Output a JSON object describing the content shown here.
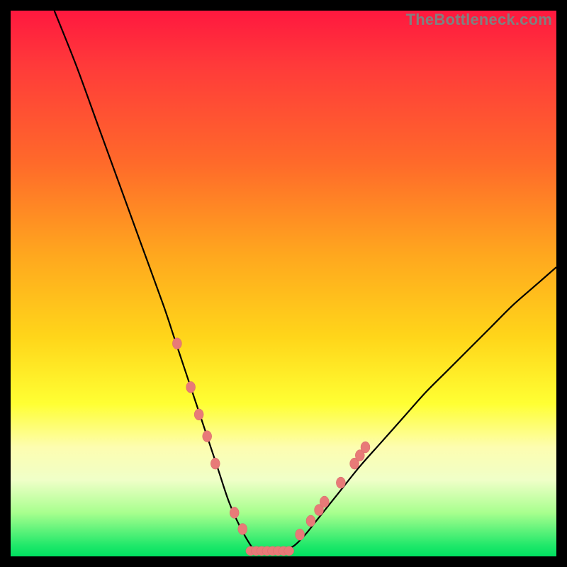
{
  "watermark": "TheBottleneck.com",
  "colors": {
    "curve_stroke": "#000000",
    "marker_fill": "#e87a78",
    "marker_stroke": "#d46a68",
    "background_black": "#000000"
  },
  "chart_data": {
    "type": "line",
    "title": "",
    "xlabel": "",
    "ylabel": "",
    "xlim": [
      0,
      100
    ],
    "ylim": [
      0,
      100
    ],
    "grid": false,
    "legend": false,
    "series": [
      {
        "name": "left-curve",
        "x": [
          8,
          12,
          16,
          20,
          24,
          28,
          30,
          32,
          34,
          36,
          38,
          40,
          42,
          44,
          45
        ],
        "values": [
          100,
          90,
          79,
          68,
          57,
          46,
          40,
          34,
          28,
          22,
          16,
          10,
          5.5,
          2,
          1
        ]
      },
      {
        "name": "right-curve",
        "x": [
          50,
          52,
          54,
          56,
          58,
          60,
          64,
          68,
          72,
          76,
          80,
          84,
          88,
          92,
          96,
          100
        ],
        "values": [
          1,
          2,
          4,
          6.5,
          9,
          11.5,
          16.5,
          21,
          25.5,
          30,
          34,
          38,
          42,
          46,
          49.5,
          53
        ]
      }
    ],
    "flat_bottom": {
      "x_start": 45,
      "x_end": 50,
      "value": 0.5
    },
    "markers_left": [
      {
        "x": 30.5,
        "y": 39
      },
      {
        "x": 33.0,
        "y": 31
      },
      {
        "x": 34.5,
        "y": 26
      },
      {
        "x": 36.0,
        "y": 22
      },
      {
        "x": 37.5,
        "y": 17
      },
      {
        "x": 41.0,
        "y": 8
      },
      {
        "x": 42.5,
        "y": 5
      }
    ],
    "markers_right": [
      {
        "x": 53.0,
        "y": 4
      },
      {
        "x": 55.0,
        "y": 6.5
      },
      {
        "x": 56.5,
        "y": 8.5
      },
      {
        "x": 57.5,
        "y": 10
      },
      {
        "x": 60.5,
        "y": 13.5
      },
      {
        "x": 63.0,
        "y": 17
      },
      {
        "x": 64.0,
        "y": 18.5
      },
      {
        "x": 65.0,
        "y": 20
      }
    ],
    "markers_bottom_bar": {
      "x_start": 44,
      "x_end": 51,
      "y": 1,
      "count": 8
    }
  }
}
